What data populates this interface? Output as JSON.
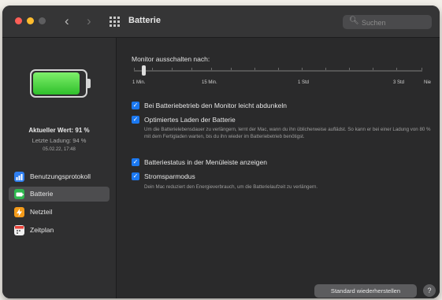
{
  "window": {
    "title": "Batterie"
  },
  "toolbar": {
    "back_glyph": "‹",
    "forward_glyph": "›",
    "search_placeholder": "Suchen"
  },
  "sidebar": {
    "current_value": "Aktueller Wert: 91 %",
    "last_charge": "Letzte Ladung: 94 %",
    "last_charge_time": "05.02.22, 17:48",
    "battery_level": 0.91,
    "items": [
      {
        "label": "Benutzungsprotokoll",
        "icon": "chart-icon",
        "active": false
      },
      {
        "label": "Batterie",
        "icon": "battery-icon",
        "active": true
      },
      {
        "label": "Netzteil",
        "icon": "power-adapter-icon",
        "active": false
      },
      {
        "label": "Zeitplan",
        "icon": "calendar-icon",
        "active": false
      }
    ]
  },
  "main": {
    "monitor_label": "Monitor ausschalten nach:",
    "slider_labels": [
      "1 Min.",
      "15 Min.",
      "1 Std",
      "3 Std",
      "Nie"
    ],
    "options": [
      {
        "label": "Bei Batteriebetrieb den Monitor leicht abdunkeln",
        "checked": true,
        "description": ""
      },
      {
        "label": "Optimiertes Laden der Batterie",
        "checked": true,
        "description": "Um die Batterielebensdauer zu verlängern, lernt der Mac, wann du ihn üblicherweise auflädst. So kann er bei einer Ladung von 80 % mit dem Fertigladen warten, bis du ihn wieder im Batteriebetrieb benötigst."
      },
      {
        "label": "Batteriestatus in der Menüleiste anzeigen",
        "checked": true,
        "description": ""
      },
      {
        "label": "Stromsparmodus",
        "checked": true,
        "description": "Dein Mac reduziert den Energieverbrauch, um die Batterielaufzeit zu verlängern."
      }
    ],
    "restore_button": "Standard wiederherstellen",
    "help_button": "?"
  },
  "colors": {
    "accent": "#1b78f0",
    "battery_fill": "#2fbf2b"
  }
}
